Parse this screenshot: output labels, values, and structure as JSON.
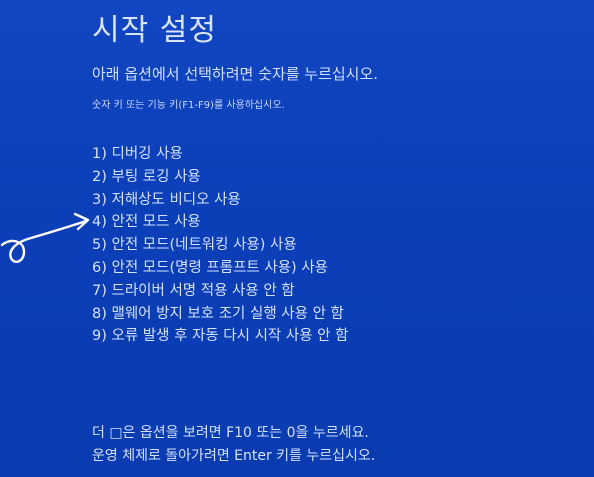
{
  "screen": {
    "title": "시작 설정",
    "subtitle": "아래 옵션에서 선택하려면 숫자를 누르십시오.",
    "hint": "숫자 키 또는 기능 키(F1-F9)를 사용하십시오.",
    "options": [
      "1) 디버깅 사용",
      "2) 부팅 로깅 사용",
      "3) 저해상도 비디오 사용",
      "4) 안전 모드 사용",
      "5) 안전 모드(네트워킹 사용) 사용",
      "6) 안전 모드(명령 프롬프트 사용) 사용",
      "7) 드라이버 서명 적용 사용 안 함",
      "8) 맬웨어 방지 보호 조기 실행 사용 안 함",
      "9) 오류 발생 후 자동 다시 시작 사용 안 함"
    ],
    "footer_line_1": "더 □은 옵션을 보려면 F10 또는 0을 누르세요.",
    "footer_line_2": "운영 체제로 돌아가려면 Enter 키를 누르십시오."
  },
  "colors": {
    "background": "#0b3fb8",
    "text": "#d5e1ff",
    "annotation": "#ffffff"
  }
}
